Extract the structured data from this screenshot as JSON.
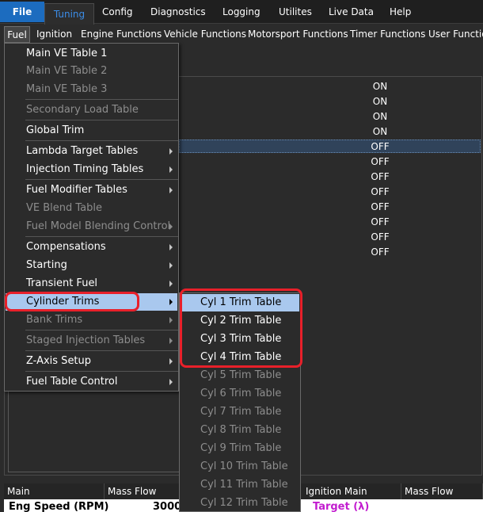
{
  "topbar": {
    "file": "File",
    "tabs": [
      "Tuning",
      "Config",
      "Diagnostics",
      "Logging",
      "Utilites",
      "Live Data",
      "Help"
    ]
  },
  "menubar": {
    "items": [
      "Fuel",
      "Ignition",
      "Engine Functions",
      "Vehicle Functions",
      "Motorsport Functions",
      "Timer Functions",
      "User Functio"
    ]
  },
  "status_values": [
    "ON",
    "ON",
    "ON",
    "ON",
    "OFF",
    "OFF",
    "OFF",
    "OFF",
    "OFF",
    "OFF",
    "OFF",
    "OFF"
  ],
  "fuel_menu": {
    "items": [
      {
        "label": "Main VE Table 1",
        "enabled": true,
        "submenu": false
      },
      {
        "label": "Main VE Table 2",
        "enabled": false,
        "submenu": false
      },
      {
        "label": "Main VE Table 3",
        "enabled": false,
        "submenu": false
      },
      {
        "label": "Secondary Load Table",
        "enabled": false,
        "submenu": false
      },
      {
        "label": "Global Trim",
        "enabled": true,
        "submenu": false
      },
      {
        "label": "Lambda Target Tables",
        "enabled": true,
        "submenu": true
      },
      {
        "label": "Injection Timing Tables",
        "enabled": true,
        "submenu": true
      },
      {
        "label": "Fuel Modifier Tables",
        "enabled": true,
        "submenu": true
      },
      {
        "label": "VE Blend Table",
        "enabled": false,
        "submenu": false
      },
      {
        "label": "Fuel Model Blending Control",
        "enabled": false,
        "submenu": true
      },
      {
        "label": "Compensations",
        "enabled": true,
        "submenu": true
      },
      {
        "label": "Starting",
        "enabled": true,
        "submenu": true
      },
      {
        "label": "Transient Fuel",
        "enabled": true,
        "submenu": true
      },
      {
        "label": "Cylinder Trims",
        "enabled": true,
        "submenu": true
      },
      {
        "label": "Bank Trims",
        "enabled": false,
        "submenu": true
      },
      {
        "label": "Staged Injection Tables",
        "enabled": false,
        "submenu": true
      },
      {
        "label": "Z-Axis Setup",
        "enabled": true,
        "submenu": true
      },
      {
        "label": "Fuel Table Control",
        "enabled": true,
        "submenu": true
      }
    ]
  },
  "cylinder_trims_menu": {
    "items": [
      {
        "label": "Cyl 1 Trim Table",
        "enabled": true
      },
      {
        "label": "Cyl 2 Trim Table",
        "enabled": true
      },
      {
        "label": "Cyl 3 Trim Table",
        "enabled": true
      },
      {
        "label": "Cyl 4 Trim Table",
        "enabled": true
      },
      {
        "label": "Cyl 5 Trim Table",
        "enabled": false
      },
      {
        "label": "Cyl 6 Trim Table",
        "enabled": false
      },
      {
        "label": "Cyl 7 Trim Table",
        "enabled": false
      },
      {
        "label": "Cyl 8 Trim Table",
        "enabled": false
      },
      {
        "label": "Cyl 9 Trim Table",
        "enabled": false
      },
      {
        "label": "Cyl 10 Trim Table",
        "enabled": false
      },
      {
        "label": "Cyl 11 Trim Table",
        "enabled": false
      },
      {
        "label": "Cyl 12 Trim Table",
        "enabled": false
      }
    ]
  },
  "bottom": {
    "cells": [
      "Main",
      "Mass Flow",
      "Ignition Main",
      "Mass Flow"
    ],
    "engine_speed": "Eng Speed (RPM)",
    "engine_speed_value": "3000",
    "target": "Target (λ)"
  },
  "colors": {
    "accent_blue": "#1c6cbf",
    "highlight": "#a9c8ee",
    "annotation_red": "#e8202a"
  }
}
